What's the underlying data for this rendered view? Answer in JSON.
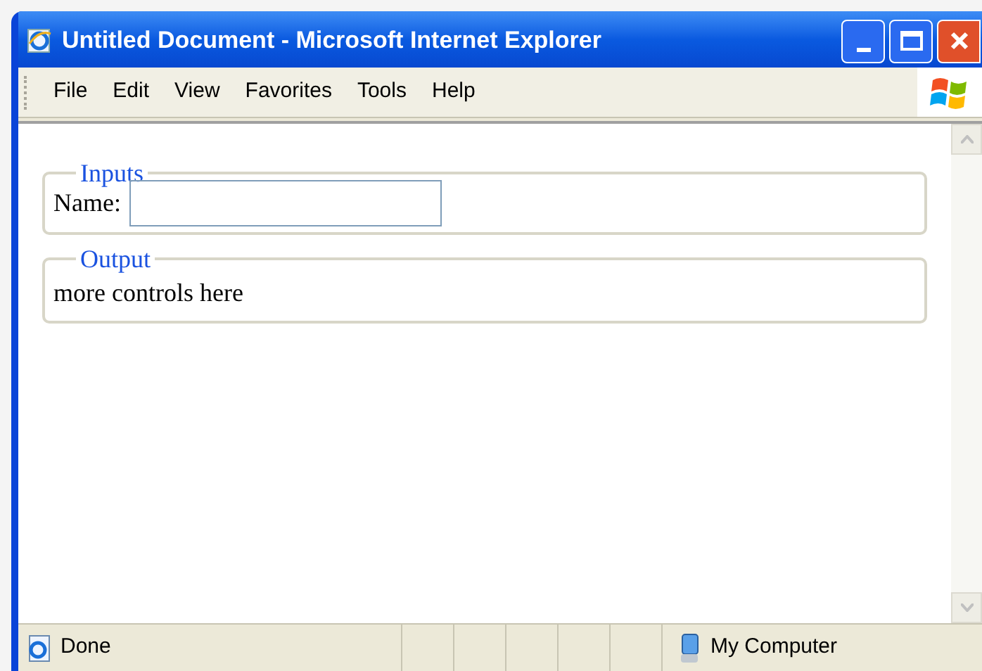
{
  "window": {
    "title": "Untitled Document - Microsoft Internet Explorer"
  },
  "menu": [
    "File",
    "Edit",
    "View",
    "Favorites",
    "Tools",
    "Help"
  ],
  "fieldsets": [
    {
      "legend": "Inputs",
      "kind": "field",
      "label": "Name:"
    },
    {
      "legend": "Output",
      "kind": "text",
      "text": "more controls here"
    }
  ],
  "status_bar": {
    "message": "Done",
    "zone": "My Computer"
  }
}
